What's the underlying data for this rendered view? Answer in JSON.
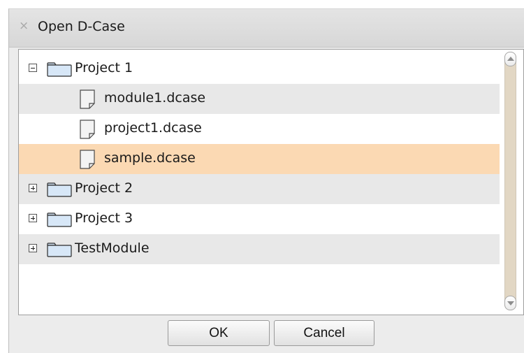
{
  "dialog": {
    "title": "Open D-Case",
    "close_icon": "close-icon"
  },
  "tree": {
    "items": [
      {
        "label": "Project 1",
        "type": "folder",
        "expanded": true
      },
      {
        "label": "module1.dcase",
        "type": "file"
      },
      {
        "label": "project1.dcase",
        "type": "file"
      },
      {
        "label": "sample.dcase",
        "type": "file",
        "selected": true
      },
      {
        "label": "Project 2",
        "type": "folder",
        "expanded": false
      },
      {
        "label": "Project 3",
        "type": "folder",
        "expanded": false
      },
      {
        "label": "TestModule",
        "type": "folder",
        "expanded": false
      }
    ],
    "selection_color": "#fbd9b3",
    "alt_row_color": "#e8e8e8"
  },
  "buttons": {
    "ok_label": "OK",
    "cancel_label": "Cancel"
  }
}
